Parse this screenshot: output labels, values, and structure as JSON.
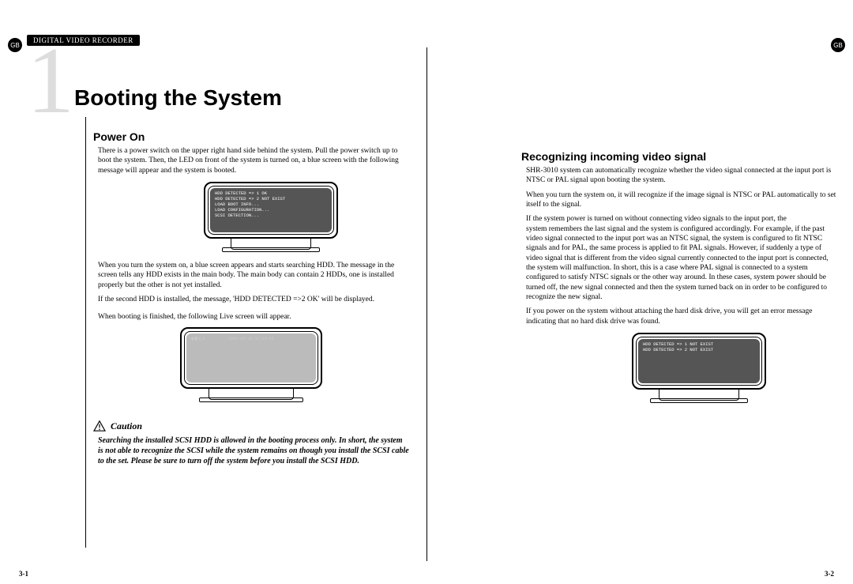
{
  "meta": {
    "lang_badge": "GB",
    "header": "DIGITAL VIDEO RECORDER",
    "chapter_number": "1",
    "chapter_title": "Booting the System",
    "page_left": "3-1",
    "page_right": "3-2"
  },
  "left": {
    "section_title": "Power On",
    "p1": "There is a power switch on the upper right hand side behind the system. Pull the power switch up to boot the system. Then, the LED on front of the system is turned on, a blue screen with the following message will appear and the system is booted.",
    "screen1_lines": "HDD DETECTED => 1 OK\nHDD DETECTED => 2 NOT EXIST\nLOAD BOOT INFO...\nLOAD CONFIGURATION...\nSCSI DETECTION...",
    "p2": "When you turn the system on, a blue screen appears and starts searching HDD. The message in the screen tells any HDD exists in the main body. The main body can contain 2 HDDs, one is installed properly but the other is not yet installed.",
    "p3": "If the second HDD is installed, the message, 'HDD DETECTED =>2 OK' will be displayed.",
    "p4": "When booting is finished, the following Live screen will appear.",
    "live_timestamp": "2001-09-15 17:14:55",
    "caution_label": "Caution",
    "caution_text": "Searching the installed SCSI HDD is allowed in the booting process only. In short, the system is not able to recognize the SCSI while the system remains on though you install the SCSI cable to the set. Please be sure to turn off the system before you install the SCSI HDD."
  },
  "right": {
    "section_title": "Recognizing incoming video signal",
    "p1": "SHR-3010 system can automatically recognize whether the video signal connected at the input port is NTSC or PAL signal upon booting the system.",
    "p2": "When you turn the system on, it will recognize if the image signal is NTSC or PAL automatically to set itself to the signal.",
    "p3": "If the system power is turned on without connecting video signals to the input port, the",
    "p4": "system remembers the last signal and the system is configured accordingly. For example, if the past video signal connected to the input port was an NTSC signal, the system is configured to fit NTSC signals and for PAL, the same process is applied to fit PAL signals. However, if suddenly a type of video signal that is different from the video signal currently connected to the input port is connected, the system will malfunction. In short, this is a case where PAL signal is connected to a system configured to satisfy NTSC signals or the other way around. In these cases, system power should be turned off, the new signal connected and then the system turned back on in order to be configured to recognize the new signal.",
    "p5": "If you power on the system without attaching the hard disk drive, you will get an error message indicating that no hard disk drive was found.",
    "screen_lines": "HDD DETECTED => 1 NOT EXIST\nHDD DETECTED => 2 NOT EXIST"
  }
}
